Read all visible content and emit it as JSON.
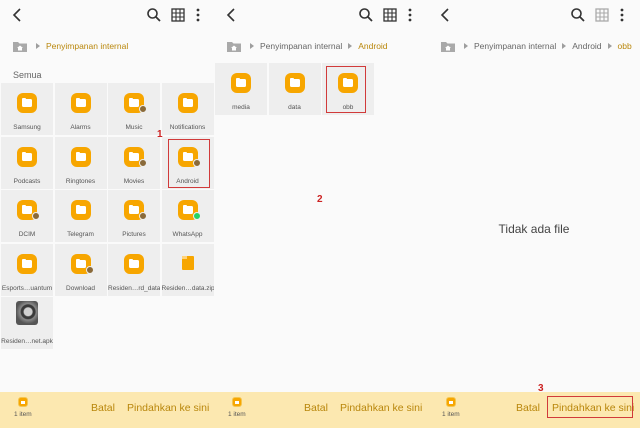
{
  "panels": [
    {
      "breadcrumb": [
        "Penyimpanan internal"
      ],
      "section_label": "Semua",
      "tiles": [
        {
          "label": "Samsung",
          "icon": "folder-icon",
          "badge": ""
        },
        {
          "label": "Alarms",
          "icon": "folder-icon",
          "badge": ""
        },
        {
          "label": "Music",
          "icon": "folder-icon",
          "badge": "music-badge-icon"
        },
        {
          "label": "Notifications",
          "icon": "folder-icon",
          "badge": ""
        },
        {
          "label": "Podcasts",
          "icon": "folder-icon",
          "badge": ""
        },
        {
          "label": "Ringtones",
          "icon": "folder-icon",
          "badge": ""
        },
        {
          "label": "Movies",
          "icon": "folder-icon",
          "badge": "play-badge-icon"
        },
        {
          "label": "Android",
          "icon": "folder-icon",
          "badge": "gear-badge-icon"
        },
        {
          "label": "DCIM",
          "icon": "folder-icon",
          "badge": "camera-badge-icon"
        },
        {
          "label": "Telegram",
          "icon": "folder-icon",
          "badge": ""
        },
        {
          "label": "Pictures",
          "icon": "folder-icon",
          "badge": "image-badge-icon"
        },
        {
          "label": "WhatsApp",
          "icon": "folder-icon",
          "badge": "whatsapp-badge-icon"
        },
        {
          "label": "Esports…uantum",
          "icon": "folder-icon",
          "badge": ""
        },
        {
          "label": "Download",
          "icon": "folder-icon",
          "badge": "download-badge-icon"
        },
        {
          "label": "Residen…rd_data",
          "icon": "folder-icon",
          "badge": ""
        },
        {
          "label": "Residen…data.zip",
          "icon": "zip-file-icon",
          "badge": ""
        },
        {
          "label": "Residen…net.apk",
          "icon": "apk-file-icon",
          "badge": ""
        }
      ],
      "bottom": {
        "count": "1 item",
        "cancel": "Batal",
        "move": "Pindahkan ke sini"
      }
    },
    {
      "breadcrumb": [
        "Penyimpanan internal",
        "Android"
      ],
      "tiles": [
        {
          "label": "media",
          "icon": "folder-icon",
          "badge": ""
        },
        {
          "label": "data",
          "icon": "folder-icon",
          "badge": ""
        },
        {
          "label": "obb",
          "icon": "folder-icon",
          "badge": ""
        }
      ],
      "bottom": {
        "count": "1 item",
        "cancel": "Batal",
        "move": "Pindahkan ke sini"
      }
    },
    {
      "breadcrumb": [
        "Penyimpanan internal",
        "Android",
        "obb"
      ],
      "empty_text": "Tidak ada file",
      "bottom": {
        "count": "1 item",
        "cancel": "Batal",
        "move": "Pindahkan ke sini"
      }
    }
  ],
  "annotations": [
    "1",
    "2",
    "3"
  ],
  "colors": {
    "accent": "#b9870c",
    "folder": "#f7a600",
    "bottom_bar": "#fce8b0",
    "highlight": "#d13a3a"
  }
}
